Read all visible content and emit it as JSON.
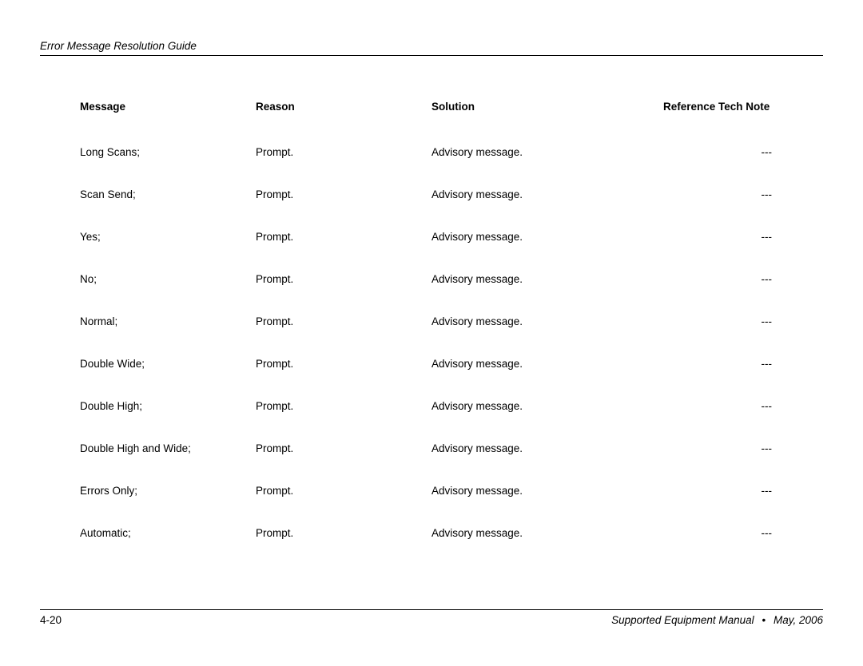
{
  "header": {
    "title": "Error Message Resolution Guide"
  },
  "table": {
    "headers": {
      "message": "Message",
      "reason": "Reason",
      "solution": "Solution",
      "reference": "Reference Tech Note"
    },
    "rows": [
      {
        "message": "Long Scans;",
        "reason": "Prompt.",
        "solution": "Advisory message.",
        "reference": "---"
      },
      {
        "message": "Scan Send;",
        "reason": "Prompt.",
        "solution": "Advisory message.",
        "reference": "---"
      },
      {
        "message": "Yes;",
        "reason": "Prompt.",
        "solution": "Advisory message.",
        "reference": "---"
      },
      {
        "message": "No;",
        "reason": "Prompt.",
        "solution": "Advisory message.",
        "reference": "---"
      },
      {
        "message": "Normal;",
        "reason": "Prompt.",
        "solution": "Advisory message.",
        "reference": "---"
      },
      {
        "message": "Double Wide;",
        "reason": "Prompt.",
        "solution": "Advisory message.",
        "reference": "---"
      },
      {
        "message": "Double High;",
        "reason": "Prompt.",
        "solution": "Advisory message.",
        "reference": "---"
      },
      {
        "message": "Double High and Wide;",
        "reason": "Prompt.",
        "solution": "Advisory message.",
        "reference": "---"
      },
      {
        "message": "Errors Only;",
        "reason": "Prompt.",
        "solution": "Advisory message.",
        "reference": "---"
      },
      {
        "message": "Automatic;",
        "reason": "Prompt.",
        "solution": "Advisory message.",
        "reference": "---"
      }
    ]
  },
  "footer": {
    "page": "4-20",
    "manual": "Supported Equipment Manual",
    "bullet": "•",
    "date": "May, 2006"
  }
}
